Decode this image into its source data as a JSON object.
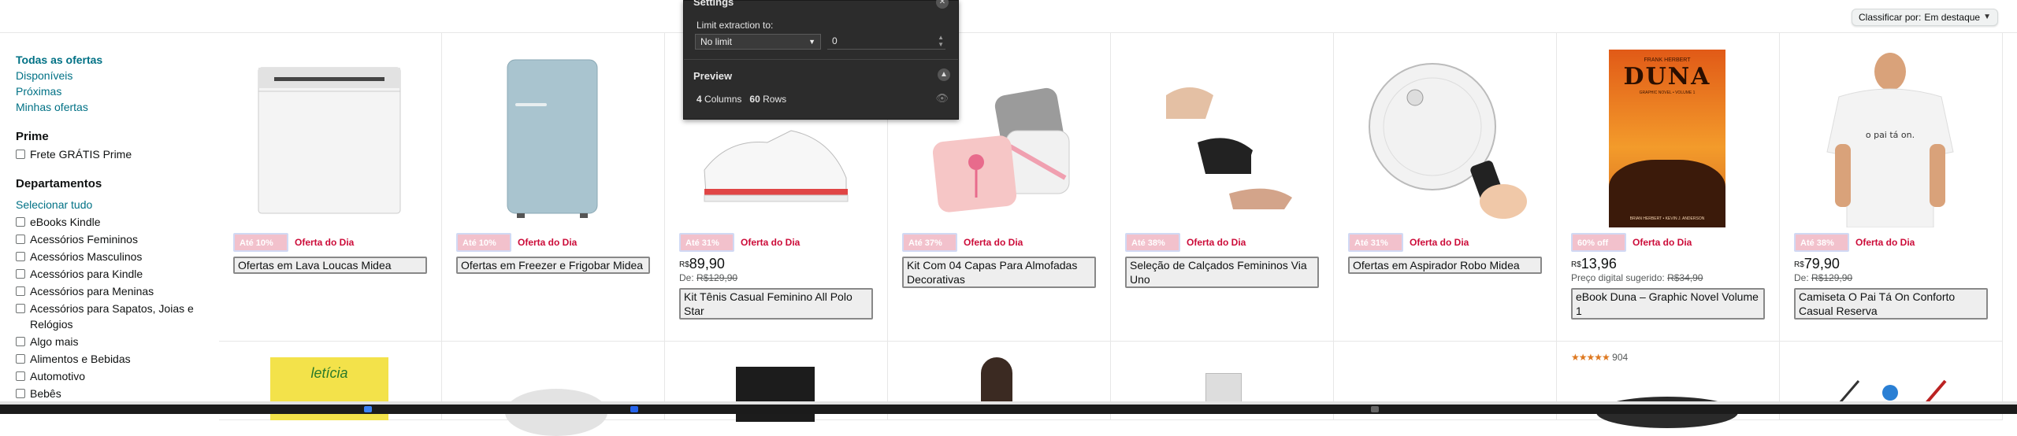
{
  "sort": {
    "label": "Classificar por:",
    "value": "Em destaque"
  },
  "sidebar": {
    "links": [
      "Todas as ofertas",
      "Disponíveis",
      "Próximas",
      "Minhas ofertas"
    ],
    "prime_heading": "Prime",
    "prime_option": "Frete GRÁTIS Prime",
    "dept_heading": "Departamentos",
    "select_all": "Selecionar tudo",
    "departments": [
      "eBooks Kindle",
      "Acessórios Femininos",
      "Acessórios Masculinos",
      "Acessórios para Kindle",
      "Acessórios para Meninas",
      "Acessórios para Sapatos, Joias e Relógios",
      "Algo mais",
      "Alimentos e Bebidas",
      "Automotivo",
      "Bebês"
    ]
  },
  "deal_label": "Oferta do Dia",
  "products": [
    {
      "title": "Ofertas em Lava Loucas Midea",
      "badge": "Até 10% off",
      "icon": "dishwasher-image"
    },
    {
      "title": "Ofertas em Freezer e Frigobar Midea",
      "badge": "Até 10% off",
      "icon": "fridge-image"
    },
    {
      "title": "Kit Tênis Casual Feminino All Polo Star",
      "badge": "Até 31% off",
      "price_cur": "R$",
      "price": "89,90",
      "was_prefix": "De:",
      "was": "R$129,90",
      "icon": "sneaker-image"
    },
    {
      "title": "Kit Com 04 Capas Para Almofadas Decorativas",
      "badge": "Até 37% off",
      "icon": "pillows-image"
    },
    {
      "title": "Seleção de Calçados Femininos Via Uno",
      "badge": "Até 38% off",
      "icon": "shoes-image"
    },
    {
      "title": "Ofertas em Aspirador Robo Midea",
      "badge": "Até 31% off",
      "icon": "robot-vacuum-image"
    },
    {
      "title": "eBook Duna – Graphic Novel Volume 1",
      "badge": "60% off",
      "price_cur": "R$",
      "price": "13,96",
      "was_prefix": "Preço digital sugerido:",
      "was": "R$34,90",
      "rating_count": "904",
      "icon": "book-cover-image",
      "book": {
        "author": "FRANK HERBERT",
        "title": "DUNA",
        "sub": "GRAPHIC NOVEL • VOLUME 1",
        "credits": "BRIAN HERBERT • KEVIN J. ANDERSON"
      }
    },
    {
      "title": "Camiseta O Pai Tá On Conforto Casual Reserva",
      "badge": "Até 38% off",
      "price_cur": "R$",
      "price": "79,90",
      "was_prefix": "De:",
      "was": "R$129,90",
      "icon": "tshirt-image",
      "shirt_text": "o pai tá on."
    }
  ],
  "overlay": {
    "title": "Settings",
    "limit_label": "Limit extraction to:",
    "limit_value": "No limit",
    "limit_number": "0",
    "preview_title": "Preview",
    "columns_count": "4",
    "columns_label": "Columns",
    "rows_count": "60",
    "rows_label": "Rows"
  },
  "second_row_book": "letícia"
}
